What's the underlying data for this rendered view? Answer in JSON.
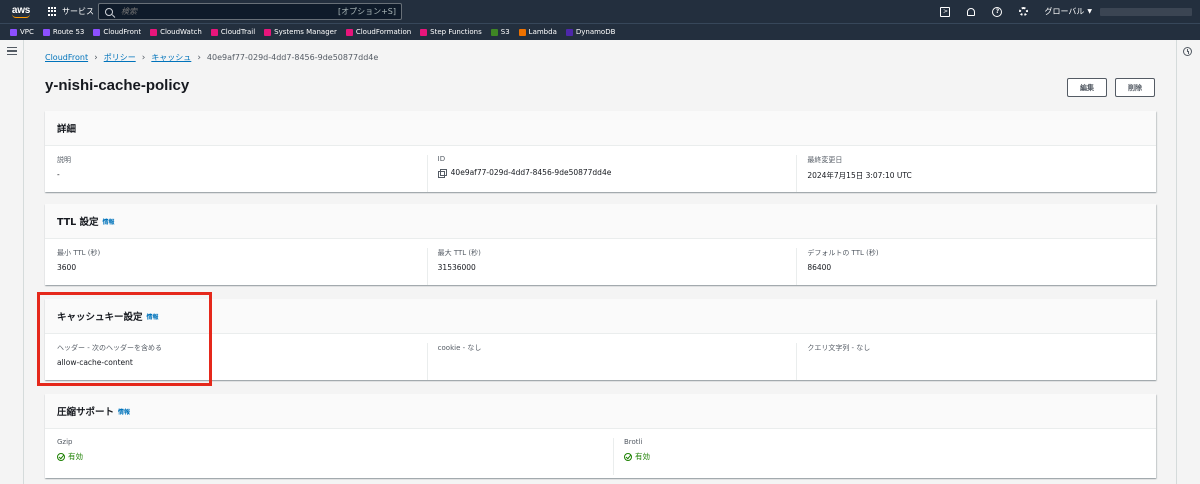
{
  "topnav": {
    "logo": "aws",
    "services_label": "サービス",
    "search_placeholder": "検索",
    "search_shortcut": "[オプション+S]",
    "region_label": "グローバル"
  },
  "favorites": [
    {
      "label": "VPC",
      "color": "#8c4fff"
    },
    {
      "label": "Route 53",
      "color": "#8c4fff"
    },
    {
      "label": "CloudFront",
      "color": "#8c4fff"
    },
    {
      "label": "CloudWatch",
      "color": "#e7157b"
    },
    {
      "label": "CloudTrail",
      "color": "#e7157b"
    },
    {
      "label": "Systems Manager",
      "color": "#e7157b"
    },
    {
      "label": "CloudFormation",
      "color": "#e7157b"
    },
    {
      "label": "Step Functions",
      "color": "#e7157b"
    },
    {
      "label": "S3",
      "color": "#3f8624"
    },
    {
      "label": "Lambda",
      "color": "#ed7100"
    },
    {
      "label": "DynamoDB",
      "color": "#4d27aa"
    }
  ],
  "breadcrumb": {
    "item1": "CloudFront",
    "item2": "ポリシー",
    "item3": "キャッシュ",
    "current": "40e9af77-029d-4dd7-8456-9de50877dd4e"
  },
  "page": {
    "title": "y-nishi-cache-policy",
    "edit_label": "編集",
    "delete_label": "削除"
  },
  "details": {
    "title": "詳細",
    "description_key": "説明",
    "description_value": "-",
    "id_key": "ID",
    "id_value": "40e9af77-029d-4dd7-8456-9de50877dd4e",
    "modified_key": "最終変更日",
    "modified_value": "2024年7月15日 3:07:10 UTC"
  },
  "ttl": {
    "title": "TTL 設定",
    "info": "情報",
    "min_key": "最小 TTL (秒)",
    "min_value": "3600",
    "max_key": "最大 TTL (秒)",
    "max_value": "31536000",
    "default_key": "デフォルトの TTL (秒)",
    "default_value": "86400"
  },
  "cache_key": {
    "title": "キャッシュキー設定",
    "info": "情報",
    "headers_key": "ヘッダー - 次のヘッダーを含める",
    "headers_value": "allow-cache-content",
    "cookie_key": "cookie - なし",
    "query_key": "クエリ文字列 - なし"
  },
  "compression": {
    "title": "圧縮サポート",
    "info": "情報",
    "gzip_key": "Gzip",
    "gzip_value": "有効",
    "brotli_key": "Brotli",
    "brotli_value": "有効"
  },
  "colors": {
    "nav_bg": "#232f3e",
    "link": "#0073bb",
    "success": "#1d8102",
    "highlight": "#e5281b"
  }
}
